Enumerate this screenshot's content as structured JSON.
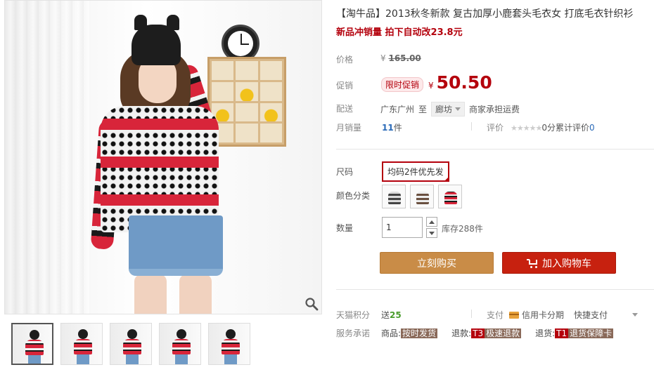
{
  "product": {
    "title": "【淘牛品】2013秋冬新款 复古加厚小鹿套头毛衣女 打底毛衣针织衫",
    "subtitle": "新品冲销量 拍下自动改23.8元"
  },
  "price": {
    "label": "价格",
    "currency": "¥",
    "original": "165.00"
  },
  "promo": {
    "label": "促销",
    "tag": "限时促销",
    "currency": "¥",
    "price": "50.50"
  },
  "shipping": {
    "label": "配送",
    "from": "广东广州",
    "to_word": "至",
    "city": "廊坊",
    "fee": "商家承担运费"
  },
  "sales": {
    "label": "月销量",
    "count": "11",
    "unit": "件",
    "review_label": "评价",
    "stars": "★★★★★",
    "score": "0分",
    "review_text": "累计评价",
    "review_count": "0"
  },
  "options": {
    "size_label": "尺码",
    "size_value": "均码2件优先发",
    "color_label": "颜色分类",
    "qty_label": "数量",
    "qty_value": "1",
    "stock": "库存288件"
  },
  "buttons": {
    "buy": "立刻购买",
    "cart": "加入购物车"
  },
  "services": {
    "points_label": "天猫积分",
    "points_prefix": "送",
    "points": "25",
    "pay_label": "支付",
    "credit": "信用卡分期",
    "quick": "快捷支付",
    "promise_label": "服务承诺",
    "item1_prefix": "商品:",
    "item1_tag": "按时发货",
    "item2_prefix": "退款:",
    "item2_code": "T3",
    "item2_tag": "极速退款",
    "item3_prefix": "退货:",
    "item3_code": "T1",
    "item3_tag": "退货保障卡"
  },
  "icons": {
    "zoom": "magnifier-icon",
    "cart": "cart-icon",
    "card": "credit-card-icon"
  },
  "colors": {
    "accent_red": "#b4000c",
    "buy_button": "#c98c47",
    "cart_button": "#c7210f",
    "count_blue": "#2a6ab8",
    "points_green": "#4a9c2d"
  }
}
